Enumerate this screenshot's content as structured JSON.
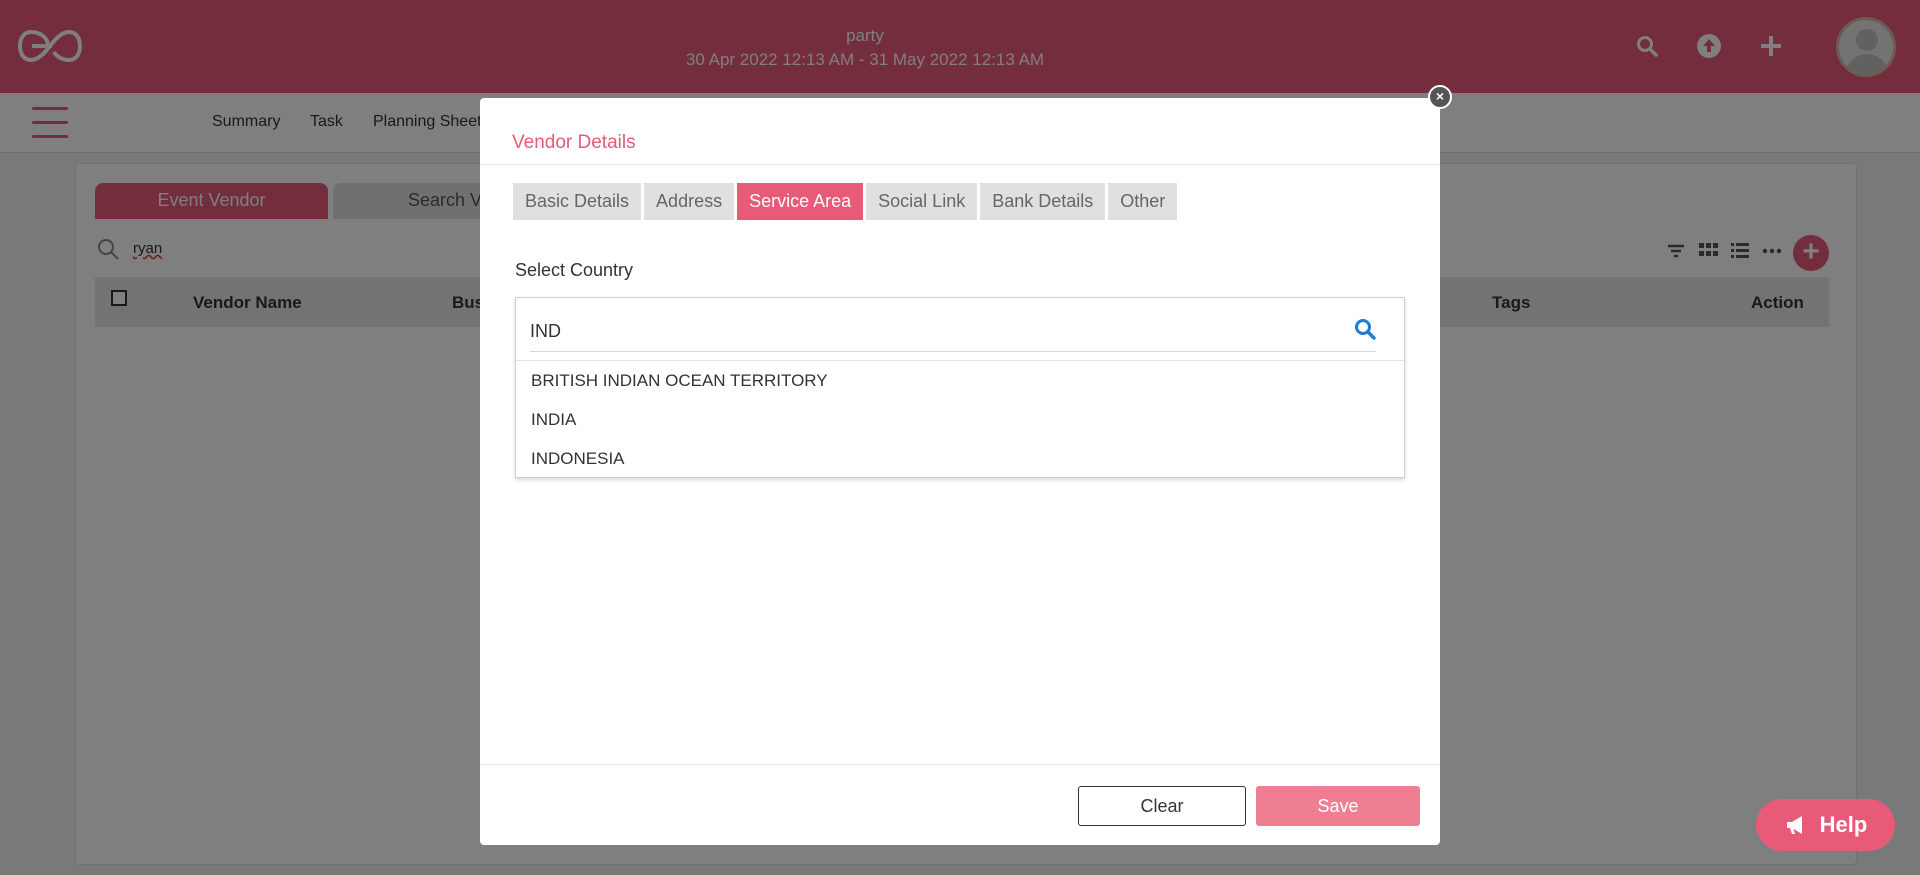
{
  "header": {
    "event_name": "party",
    "event_dates": "30 Apr 2022 12:13 AM - 31 May 2022 12:13 AM",
    "icons": [
      "logo-icon",
      "search-icon",
      "upload-icon",
      "plus-icon",
      "avatar"
    ]
  },
  "subnav": {
    "items": [
      "Summary",
      "Task",
      "Planning Sheet"
    ]
  },
  "background": {
    "tabs": [
      "Event Vendor",
      "Search Ve"
    ],
    "search_value": "ryan",
    "columns": [
      "Vendor Name",
      "Bus",
      "Tags",
      "Action"
    ]
  },
  "modal": {
    "title": "Vendor Details",
    "tabs": [
      {
        "label": "Basic Details",
        "active": false
      },
      {
        "label": "Address",
        "active": false
      },
      {
        "label": "Service Area",
        "active": true
      },
      {
        "label": "Social Link",
        "active": false
      },
      {
        "label": "Bank Details",
        "active": false
      },
      {
        "label": "Other",
        "active": false
      }
    ],
    "field_label": "Select Country",
    "search_value": "IND",
    "options": [
      "BRITISH INDIAN OCEAN TERRITORY",
      "INDIA",
      "INDONESIA"
    ],
    "close_label": "×",
    "clear_label": "Clear",
    "save_label": "Save"
  },
  "help": {
    "label": "Help"
  },
  "colors": {
    "brand": "#e75a78",
    "save_button": "#f07e93",
    "search_icon": "#1e7bd8"
  }
}
